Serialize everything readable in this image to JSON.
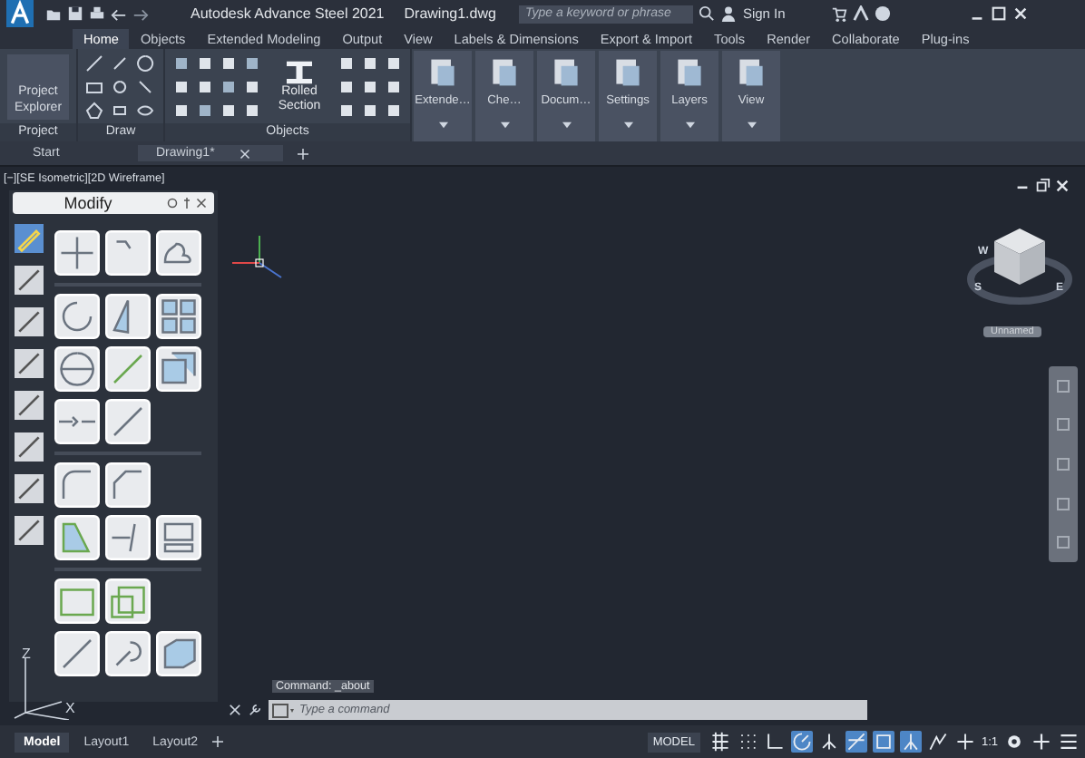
{
  "window": {
    "title": "Autodesk Advance Steel 2021",
    "document": "Drawing1.dwg"
  },
  "search": {
    "placeholder": "Type a keyword or phrase"
  },
  "account": {
    "label": "Sign In"
  },
  "ribbon_tabs": [
    {
      "label": "Home",
      "selected": true
    },
    {
      "label": "Objects",
      "selected": false
    },
    {
      "label": "Extended Modeling",
      "selected": false
    },
    {
      "label": "Output",
      "selected": false
    },
    {
      "label": "View",
      "selected": false
    },
    {
      "label": "Labels & Dimensions",
      "selected": false
    },
    {
      "label": "Export & Import",
      "selected": false
    },
    {
      "label": "Tools",
      "selected": false
    },
    {
      "label": "Render",
      "selected": false
    },
    {
      "label": "Collaborate",
      "selected": false
    },
    {
      "label": "Plug-ins",
      "selected": false
    }
  ],
  "ribbon_panels": [
    {
      "title": "Project",
      "kind": "project",
      "button": "Project Explorer"
    },
    {
      "title": "Draw",
      "kind": "draw"
    },
    {
      "title": "Objects",
      "kind": "objects",
      "button": "Rolled Section"
    }
  ],
  "ribbon_large_buttons": [
    {
      "label": "Extende…"
    },
    {
      "label": "Che…"
    },
    {
      "label": "Docum…"
    },
    {
      "label": "Settings"
    },
    {
      "label": "Layers"
    },
    {
      "label": "View"
    }
  ],
  "doc_tabs": [
    {
      "label": "Start",
      "selected": false,
      "closable": false
    },
    {
      "label": "Drawing1*",
      "selected": true,
      "closable": true
    }
  ],
  "viewport": {
    "label": "[−][SE Isometric][2D Wireframe]",
    "axes": [
      "Z",
      "X"
    ]
  },
  "palette": {
    "title": "Modify"
  },
  "viewcube": {
    "label": "Unnamed",
    "compass": [
      "W",
      "S",
      "E"
    ]
  },
  "command": {
    "history": "Command:  _about",
    "placeholder": "Type a command"
  },
  "layout_tabs": [
    {
      "label": "Model",
      "selected": true
    },
    {
      "label": "Layout1",
      "selected": false
    },
    {
      "label": "Layout2",
      "selected": false
    }
  ],
  "status_bar": {
    "space": "MODEL",
    "scale": "1:1",
    "toggles": [
      {
        "kind": "grid",
        "on": false
      },
      {
        "kind": "snap",
        "on": false
      },
      {
        "kind": "ortho",
        "on": false
      },
      {
        "kind": "polar",
        "on": true
      },
      {
        "kind": "iso",
        "on": false
      },
      {
        "kind": "track",
        "on": true
      },
      {
        "kind": "osnap",
        "on": true
      },
      {
        "kind": "annotate",
        "on": true
      },
      {
        "kind": "visible",
        "on": false
      },
      {
        "kind": "scale",
        "on": false
      }
    ]
  }
}
